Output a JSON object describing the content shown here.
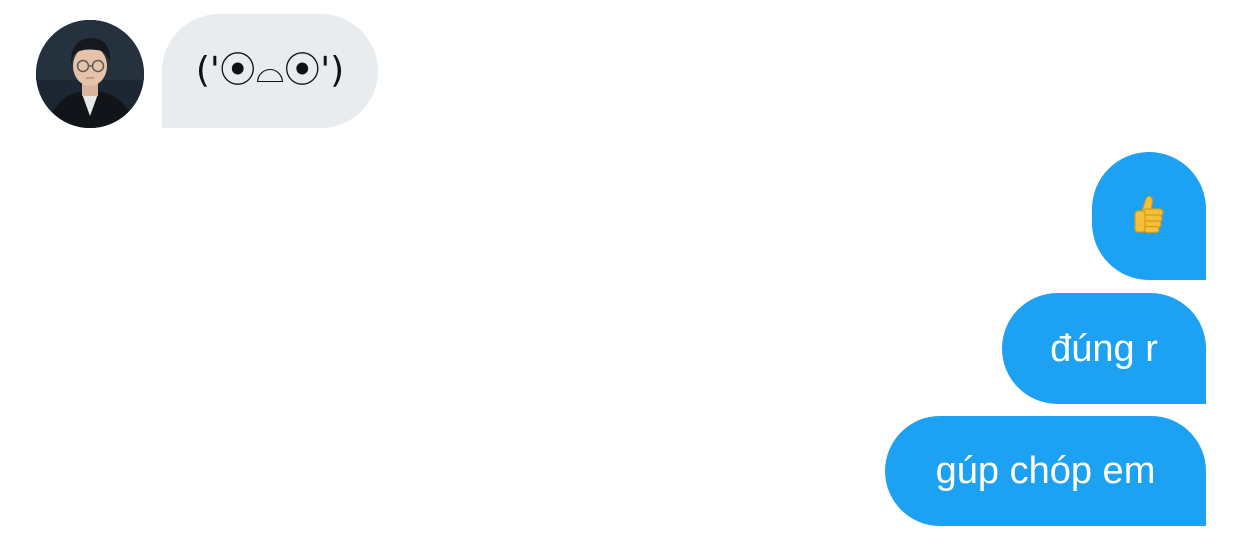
{
  "conversation": {
    "contact": {
      "avatar_alt": "contact-avatar"
    },
    "messages": [
      {
        "direction": "incoming",
        "text": "('⦿⌓⦿')"
      },
      {
        "direction": "outgoing",
        "type": "emoji",
        "icon": "thumbs-up-icon"
      },
      {
        "direction": "outgoing",
        "text": "đúng r"
      },
      {
        "direction": "outgoing",
        "text": "gúp chóp em"
      }
    ]
  },
  "colors": {
    "incoming_bubble": "#e8ecef",
    "outgoing_bubble": "#1da1f2",
    "incoming_text": "#111111",
    "outgoing_text": "#ffffff",
    "thumb_emoji": "#f4c03a"
  }
}
